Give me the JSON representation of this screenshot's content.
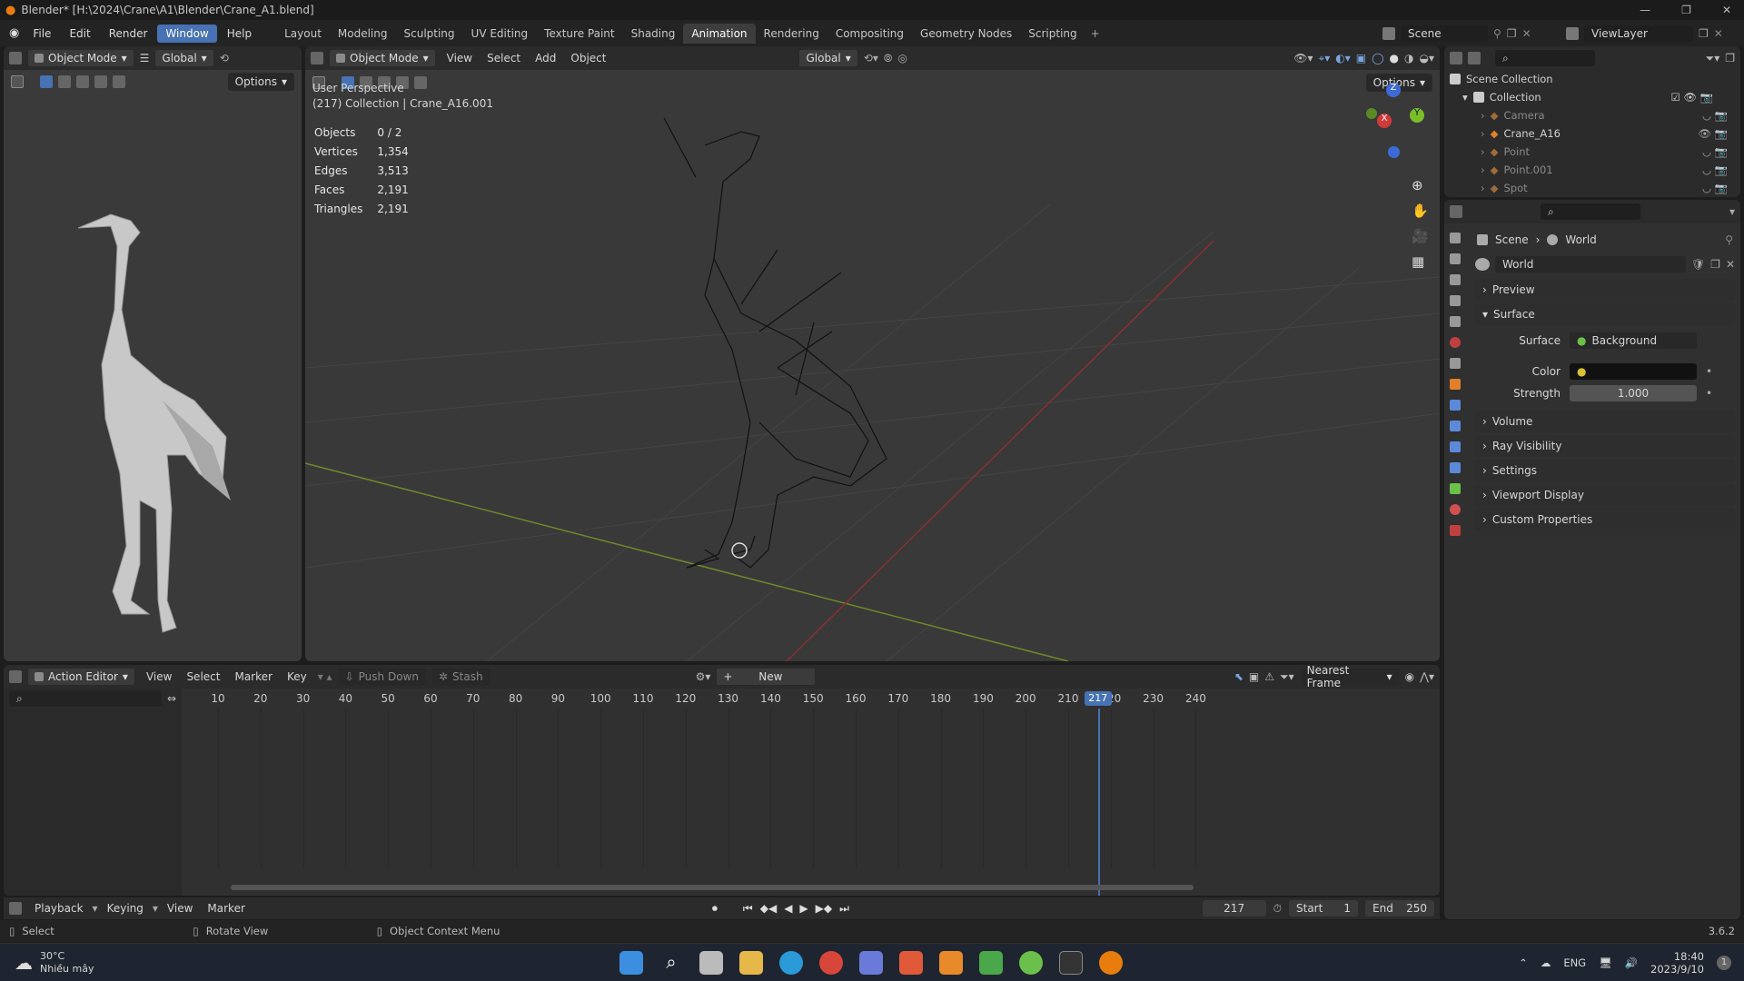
{
  "window": {
    "title": "Blender* [H:\\2024\\Crane\\A1\\Blender\\Crane_A1.blend]"
  },
  "menu": [
    "File",
    "Edit",
    "Render",
    "Window",
    "Help"
  ],
  "menu_active": "Window",
  "workspaces": [
    "Layout",
    "Modeling",
    "Sculpting",
    "UV Editing",
    "Texture Paint",
    "Shading",
    "Animation",
    "Rendering",
    "Compositing",
    "Geometry Nodes",
    "Scripting"
  ],
  "workspace_active": "Animation",
  "scene": {
    "label": "Scene",
    "viewlayer": "ViewLayer"
  },
  "left_view": {
    "mode": "Object Mode",
    "orientation": "Global",
    "options": "Options"
  },
  "viewport": {
    "mode": "Object Mode",
    "menus": [
      "View",
      "Select",
      "Add",
      "Object"
    ],
    "orientation": "Global",
    "options": "Options",
    "perspective": "User Perspective",
    "collection_info": "(217) Collection | Crane_A16.001",
    "stats": [
      {
        "label": "Objects",
        "value": "0 / 2"
      },
      {
        "label": "Vertices",
        "value": "1,354"
      },
      {
        "label": "Edges",
        "value": "3,513"
      },
      {
        "label": "Faces",
        "value": "2,191"
      },
      {
        "label": "Triangles",
        "value": "2,191"
      }
    ],
    "gizmo": {
      "z": "Z",
      "y": "Y",
      "x": "X"
    }
  },
  "outliner": {
    "root": "Scene Collection",
    "collection": "Collection",
    "items": [
      {
        "name": "Camera",
        "dim": true
      },
      {
        "name": "Crane_A16",
        "dim": false
      },
      {
        "name": "Point",
        "dim": true
      },
      {
        "name": "Point.001",
        "dim": true
      },
      {
        "name": "Spot",
        "dim": true
      }
    ]
  },
  "properties": {
    "breadcrumb_scene": "Scene",
    "breadcrumb_world": "World",
    "world_name": "World",
    "panels_top": [
      "Preview"
    ],
    "surface_panel": "Surface",
    "surface_label": "Surface",
    "surface_value": "Background",
    "color_label": "Color",
    "strength_label": "Strength",
    "strength_value": "1.000",
    "panels_bottom": [
      "Volume",
      "Ray Visibility",
      "Settings",
      "Viewport Display",
      "Custom Properties"
    ]
  },
  "action_editor": {
    "mode": "Action Editor",
    "menus": [
      "View",
      "Select",
      "Marker",
      "Key"
    ],
    "push_down": "Push Down",
    "stash": "Stash",
    "new": "New",
    "snap": "Nearest Frame",
    "frames": [
      "10",
      "20",
      "30",
      "40",
      "50",
      "60",
      "70",
      "80",
      "90",
      "100",
      "110",
      "120",
      "130",
      "140",
      "150",
      "160",
      "170",
      "180",
      "190",
      "200",
      "210",
      "220",
      "230",
      "240"
    ],
    "current_frame": "217"
  },
  "playback": {
    "menus": [
      "Playback",
      "Keying",
      "View",
      "Marker"
    ],
    "current_frame": "217",
    "start_label": "Start",
    "start_value": "1",
    "end_label": "End",
    "end_value": "250"
  },
  "statusbar": {
    "select": "Select",
    "rotate": "Rotate View",
    "context": "Object Context Menu",
    "version": "3.6.2"
  },
  "taskbar": {
    "temp": "30°C",
    "weather": "Nhiều mây",
    "lang": "ENG",
    "time": "18:40",
    "date": "2023/9/10",
    "badge": "1"
  }
}
